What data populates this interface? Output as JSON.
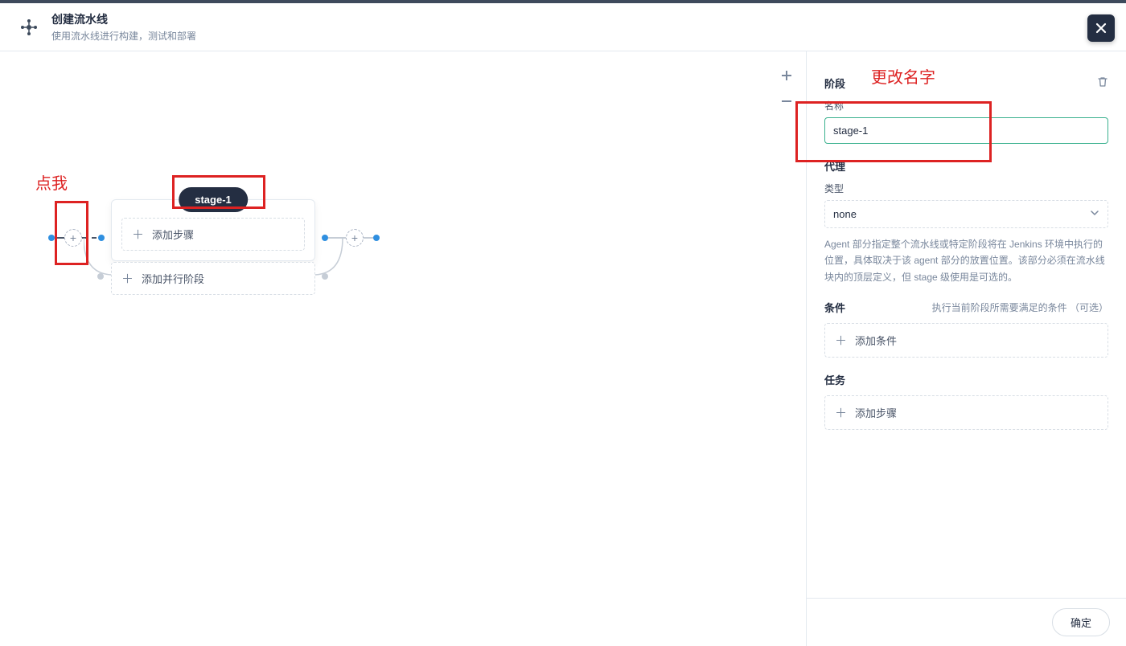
{
  "header": {
    "title": "创建流水线",
    "subtitle": "使用流水线进行构建，测试和部署"
  },
  "canvas": {
    "stage_pill": "stage-1",
    "add_step": "添加步骤",
    "add_parallel": "添加并行阶段"
  },
  "annotations": {
    "click_me": "点我",
    "change_name": "更改名字"
  },
  "sidebar": {
    "section_stage": "阶段",
    "name_label": "名称",
    "name_value": "stage-1",
    "section_agent": "代理",
    "type_label": "类型",
    "agent_value": "none",
    "agent_help": "Agent 部分指定整个流水线或特定阶段将在 Jenkins 环境中执行的位置，具体取决于该 agent 部分的放置位置。该部分必须在流水线块内的顶层定义，但 stage 级使用是可选的。",
    "section_conditions": "条件",
    "conditions_help": "执行当前阶段所需要满足的条件 （可选）",
    "add_condition": "添加条件",
    "section_tasks": "任务",
    "add_task_step": "添加步骤",
    "confirm": "确定"
  }
}
